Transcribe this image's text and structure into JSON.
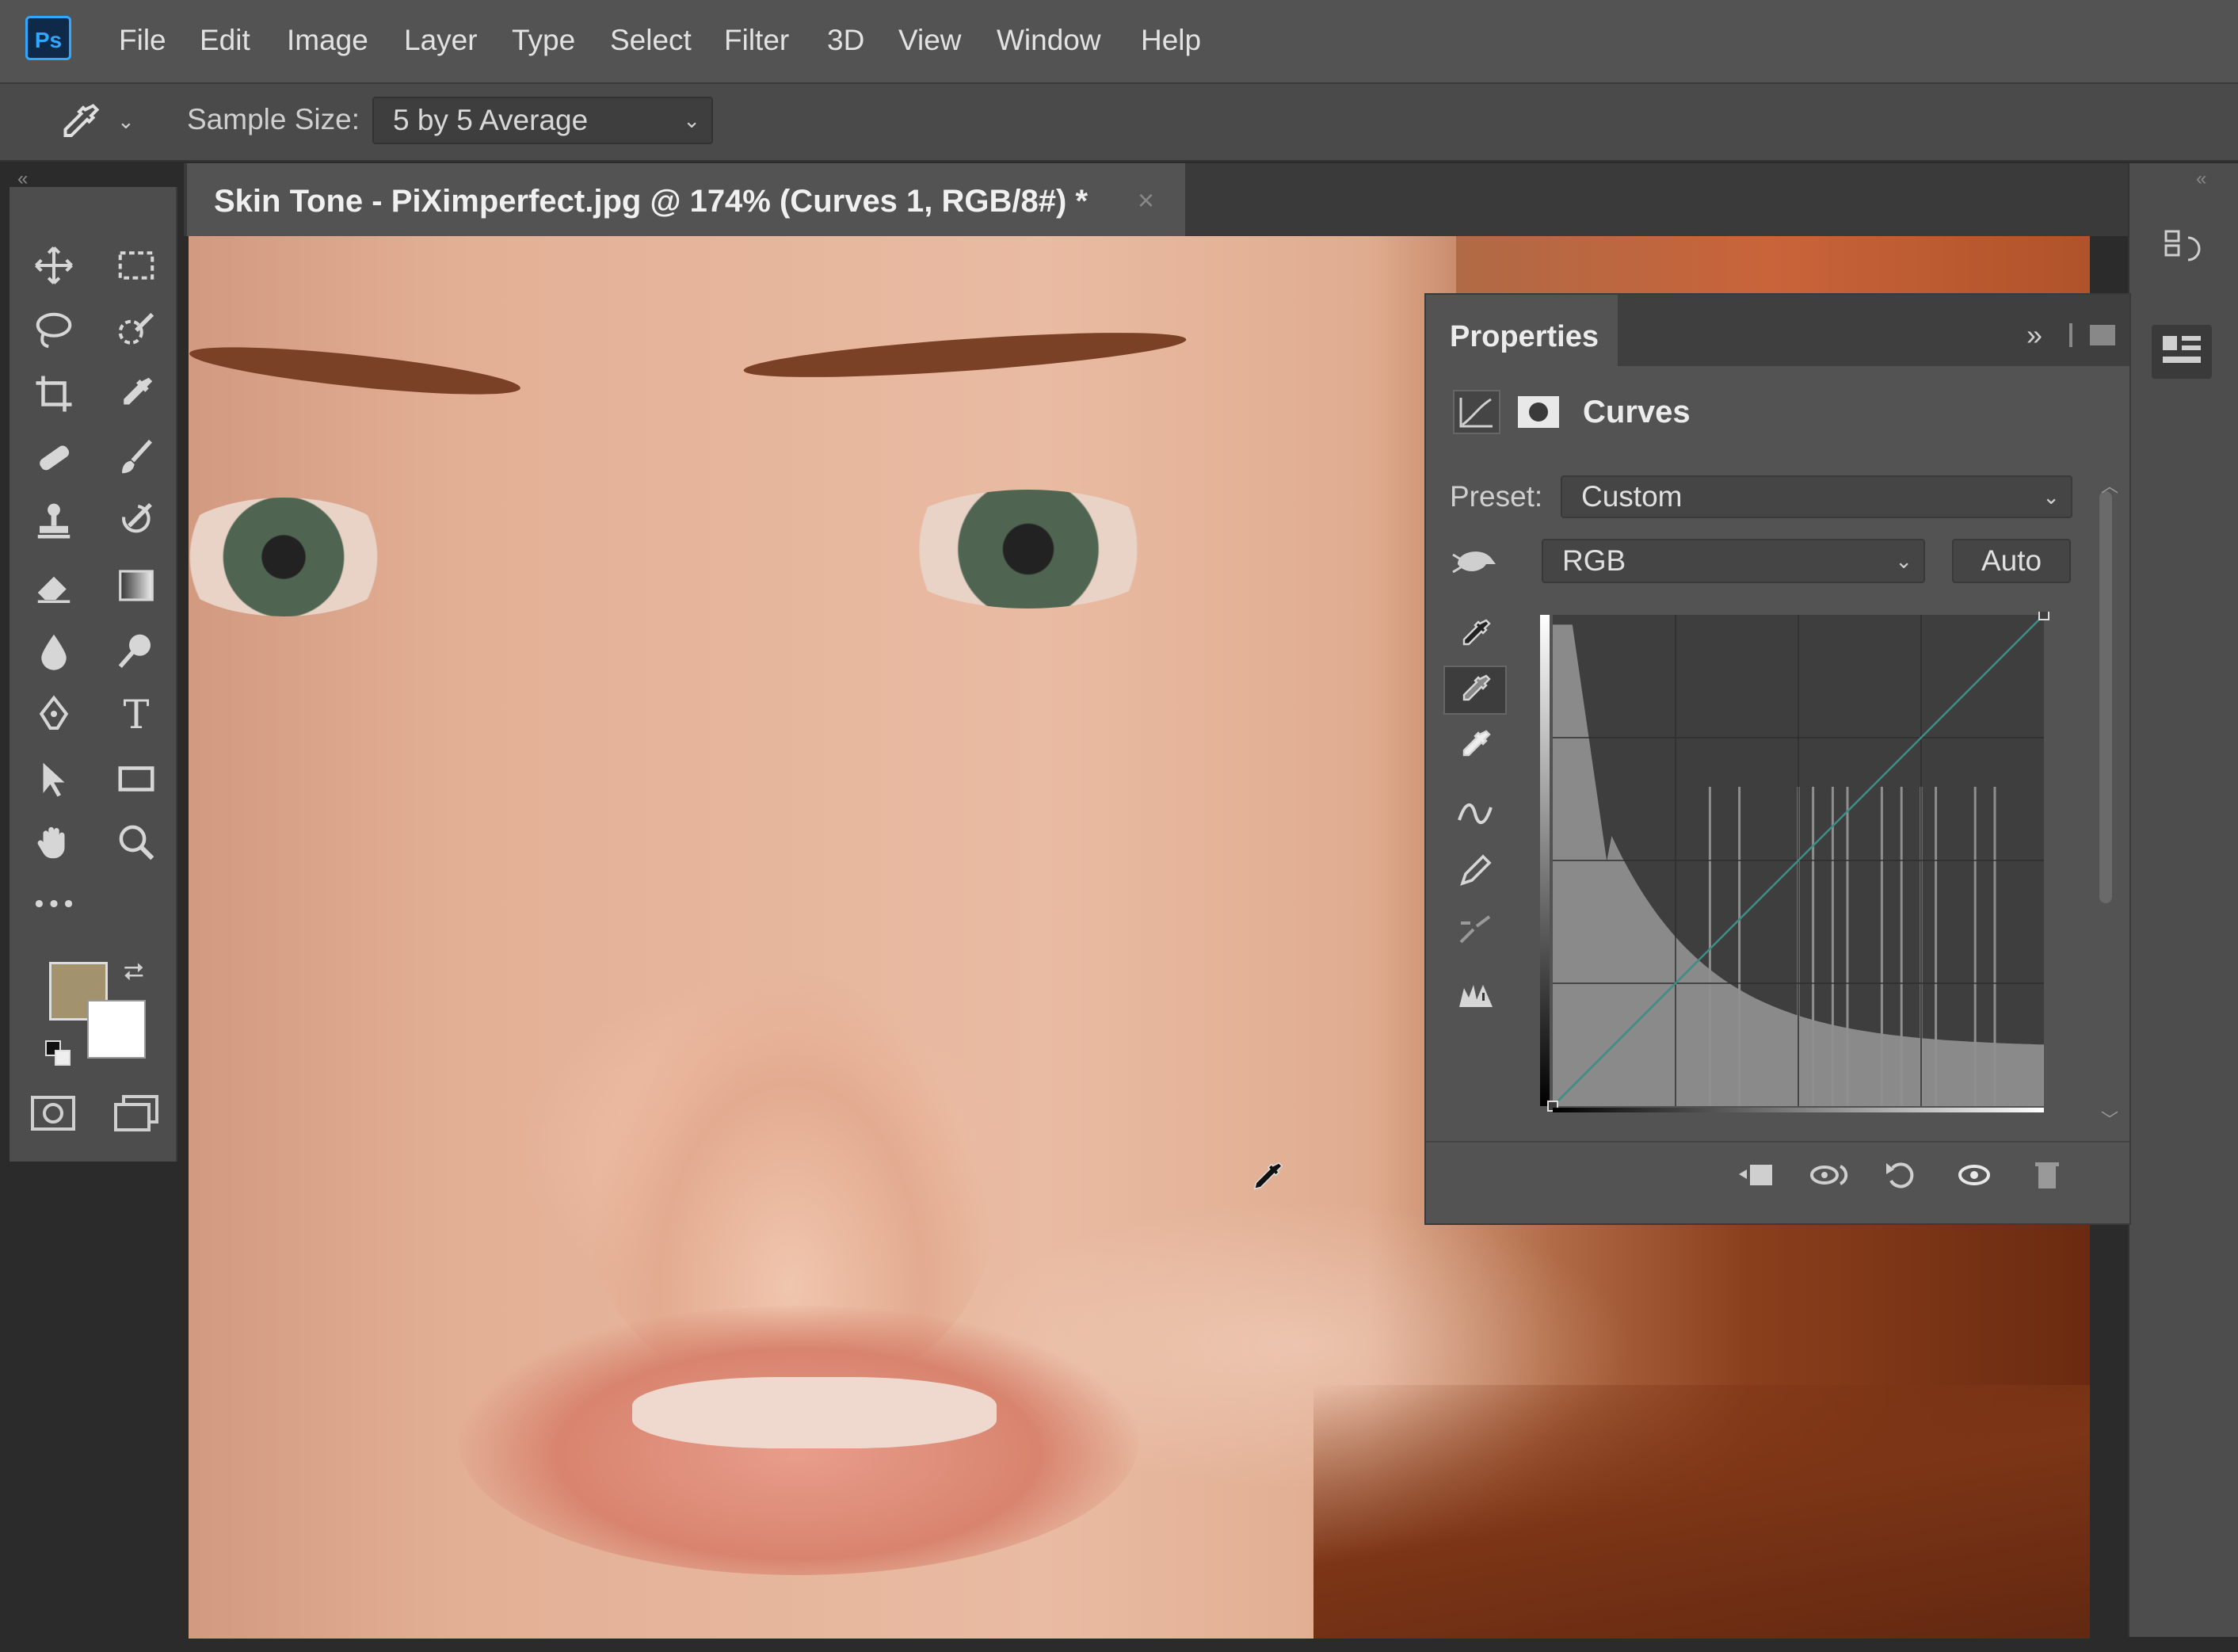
{
  "app": {
    "logo_text": "Ps"
  },
  "menu": [
    "File",
    "Edit",
    "Image",
    "Layer",
    "Type",
    "Select",
    "Filter",
    "3D",
    "View",
    "Window",
    "Help"
  ],
  "options_bar": {
    "sample_size_label": "Sample Size:",
    "sample_size_value": "5 by 5 Average"
  },
  "document": {
    "tab_title": "Skin Tone - PiXimperfect.jpg @ 174% (Curves 1, RGB/8#) *",
    "close_symbol": "×"
  },
  "toolbar": {
    "tools": [
      "move-icon",
      "marquee-icon",
      "lasso-icon",
      "quick-selection-icon",
      "crop-icon",
      "eyedropper-icon",
      "healing-brush-icon",
      "brush-icon",
      "clone-stamp-icon",
      "history-brush-icon",
      "eraser-icon",
      "gradient-icon",
      "blur-icon",
      "dodge-icon",
      "pen-icon",
      "type-icon",
      "path-selection-icon",
      "rectangle-icon",
      "hand-icon",
      "zoom-icon",
      "more-tools-icon"
    ],
    "type_tool_glyph": "T",
    "more_glyph": "•••",
    "foreground_color": "#a2926d",
    "background_color": "#ffffff"
  },
  "properties": {
    "tab_label": "Properties",
    "panel_menu": "»",
    "adjustment_title": "Curves",
    "preset_label": "Preset:",
    "preset_value": "Custom",
    "channel_value": "RGB",
    "auto_label": "Auto",
    "graph": {
      "curve_points": [
        [
          0,
          0
        ],
        [
          255,
          255
        ]
      ],
      "histogram_spikes_pct": [
        0.32,
        0.38,
        0.5,
        0.53,
        0.57,
        0.6,
        0.67,
        0.71,
        0.75,
        0.78,
        0.86,
        0.9
      ],
      "background_hex": "#3e3e3e",
      "histogram_hex": "#8a8a8a"
    }
  },
  "colors": {
    "menubar": "#535353",
    "panel": "#535353",
    "accent": "#31a8ff"
  }
}
